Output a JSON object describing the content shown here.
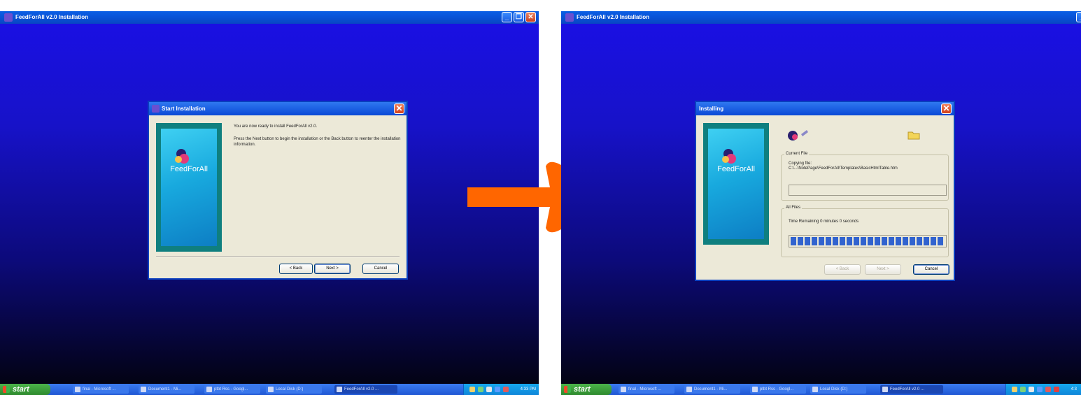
{
  "left": {
    "app_title": "FeedForAll v2.0 Installation",
    "dialog": {
      "title": "Start Installation",
      "logo_text": "FeedForAll",
      "line1": "You are now ready to install FeedForAll v2.0.",
      "line2": "Press the Next button to begin the installation or the Back button to reenter the installation information.",
      "back": "< Back",
      "next": "Next >",
      "cancel": "Cancel"
    },
    "clock": "4:33 PM"
  },
  "right": {
    "app_title": "FeedForAll v2.0 Installation",
    "dialog": {
      "title": "Installing",
      "logo_text": "FeedForAll",
      "current_file_label": "Current File",
      "copying": "Copying file:",
      "path": "C:\\...\\NotePage\\FeedForAll\\Templates\\BasicHtmlTable.htm",
      "all_files_label": "All Files",
      "time_remaining": "Time Remaining 0 minutes 0 seconds",
      "overall_progress": 1.0,
      "back": "< Back",
      "next": "Next >",
      "cancel": "Cancel"
    },
    "clock": "4:3"
  },
  "taskbar": {
    "start": "start",
    "tasks": [
      "final - Microsoft ...",
      "Document1 - Mi...",
      "ptbt Rss - Googl...",
      "Local Disk (D:)",
      "FeedForAll v2.0 ..."
    ]
  },
  "colors": {
    "arrow": "#ff6600",
    "desktop_top": "#1a10e6",
    "titlebar": "#0a49d6"
  }
}
